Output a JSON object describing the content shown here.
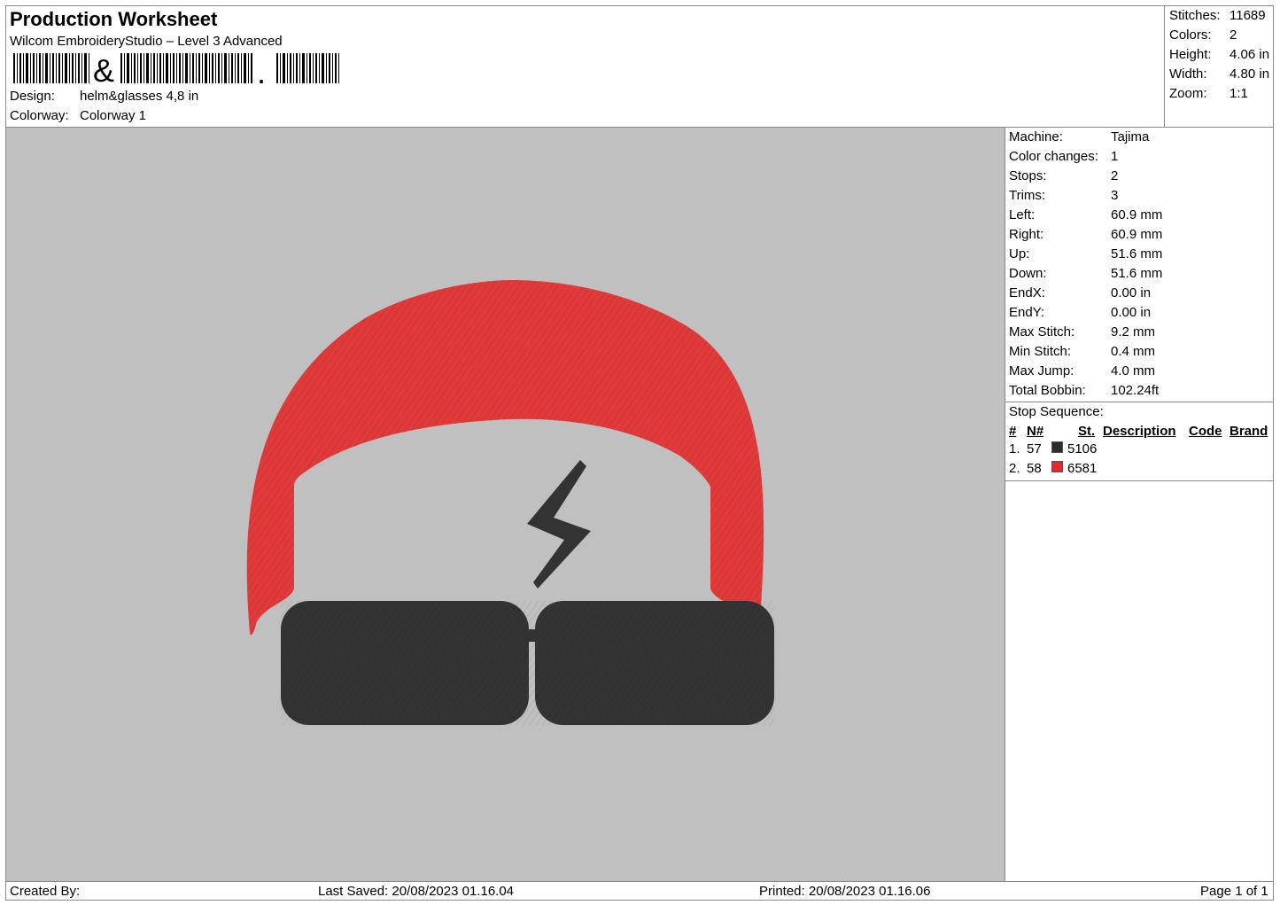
{
  "header": {
    "title": "Production Worksheet",
    "software": "Wilcom EmbroideryStudio – Level 3 Advanced",
    "design_label": "Design:",
    "design_value": "helm&glasses 4,8 in",
    "colorway_label": "Colorway:",
    "colorway_value": "Colorway 1"
  },
  "stats": [
    {
      "label": "Stitches:",
      "value": "11689"
    },
    {
      "label": "Colors:",
      "value": "2"
    },
    {
      "label": "Height:",
      "value": "4.06 in"
    },
    {
      "label": "Width:",
      "value": "4.80 in"
    },
    {
      "label": "Zoom:",
      "value": "1:1"
    }
  ],
  "machine_info": [
    {
      "label": "Machine:",
      "value": "Tajima"
    },
    {
      "label": "Color changes:",
      "value": "1"
    },
    {
      "label": "Stops:",
      "value": "2"
    },
    {
      "label": "Trims:",
      "value": "3"
    },
    {
      "label": "Left:",
      "value": "60.9 mm"
    },
    {
      "label": "Right:",
      "value": "60.9 mm"
    },
    {
      "label": "Up:",
      "value": "51.6 mm"
    },
    {
      "label": "Down:",
      "value": "51.6 mm"
    },
    {
      "label": "EndX:",
      "value": "0.00 in"
    },
    {
      "label": "EndY:",
      "value": "0.00 in"
    },
    {
      "label": "Max Stitch:",
      "value": "9.2 mm"
    },
    {
      "label": "Min Stitch:",
      "value": "0.4 mm"
    },
    {
      "label": "Max Jump:",
      "value": "4.0 mm"
    },
    {
      "label": "Total Bobbin:",
      "value": "102.24ft"
    }
  ],
  "stop_sequence": {
    "title": "Stop Sequence:",
    "columns": [
      "#",
      "N#",
      "St.",
      "Description",
      "Code",
      "Brand"
    ],
    "rows": [
      {
        "index": "1.",
        "n": "57",
        "st": "5106",
        "color": "#2b2b2b"
      },
      {
        "index": "2.",
        "n": "58",
        "st": "6581",
        "color": "#e8242c"
      }
    ]
  },
  "colors": {
    "helmet": "#e03a3a",
    "glasses": "#333333",
    "background": "#c0c0c0"
  },
  "footer": {
    "created_by": "Created By:",
    "last_saved": "Last Saved: 20/08/2023 01.16.04",
    "printed": "Printed: 20/08/2023 01.16.06",
    "page": "Page 1 of 1"
  }
}
